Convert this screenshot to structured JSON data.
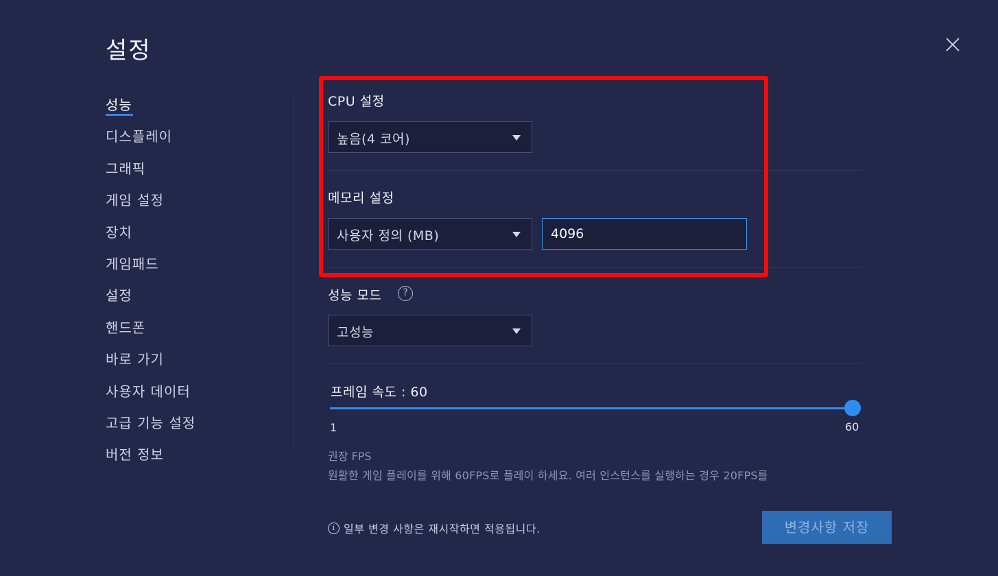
{
  "window": {
    "title": "설정",
    "close_icon": "close-icon"
  },
  "sidebar": {
    "items": [
      {
        "label": "성능",
        "active": true
      },
      {
        "label": "디스플레이"
      },
      {
        "label": "그래픽"
      },
      {
        "label": "게임 설정"
      },
      {
        "label": "장치"
      },
      {
        "label": "게임패드"
      },
      {
        "label": "설정"
      },
      {
        "label": "핸드폰"
      },
      {
        "label": "바로 가기"
      },
      {
        "label": "사용자 데이터"
      },
      {
        "label": "고급 기능 설정"
      },
      {
        "label": "버전 정보"
      }
    ]
  },
  "cpu": {
    "label": "CPU 설정",
    "selected": "높음(4 코어)"
  },
  "memory": {
    "label": "메모리 설정",
    "selected": "사용자 정의 (MB)",
    "value": "4096"
  },
  "performance_mode": {
    "label": "성능 모드",
    "help_icon": "question-circle-icon",
    "selected": "고성능"
  },
  "frame_rate": {
    "label": "프레임 속도 : 60",
    "value": 60,
    "min": 1,
    "max": 60,
    "min_label": "1",
    "max_label": "60"
  },
  "recommended": {
    "title": "권장 FPS",
    "text": "원활한 게임 플레이를 위해 60FPS로 플레이 하세요. 여러 인스턴스를 실행하는 경우 20FPS를"
  },
  "footer": {
    "info_icon": "info-circle-icon",
    "info_text": "일부 변경 사항은 재시작하면 적용됩니다.",
    "save_label": "변경사항 저장"
  },
  "colors": {
    "background": "#23284a",
    "accent": "#2f8df2",
    "highlight": "#f20c0c",
    "save_button": "#2e6db4"
  }
}
